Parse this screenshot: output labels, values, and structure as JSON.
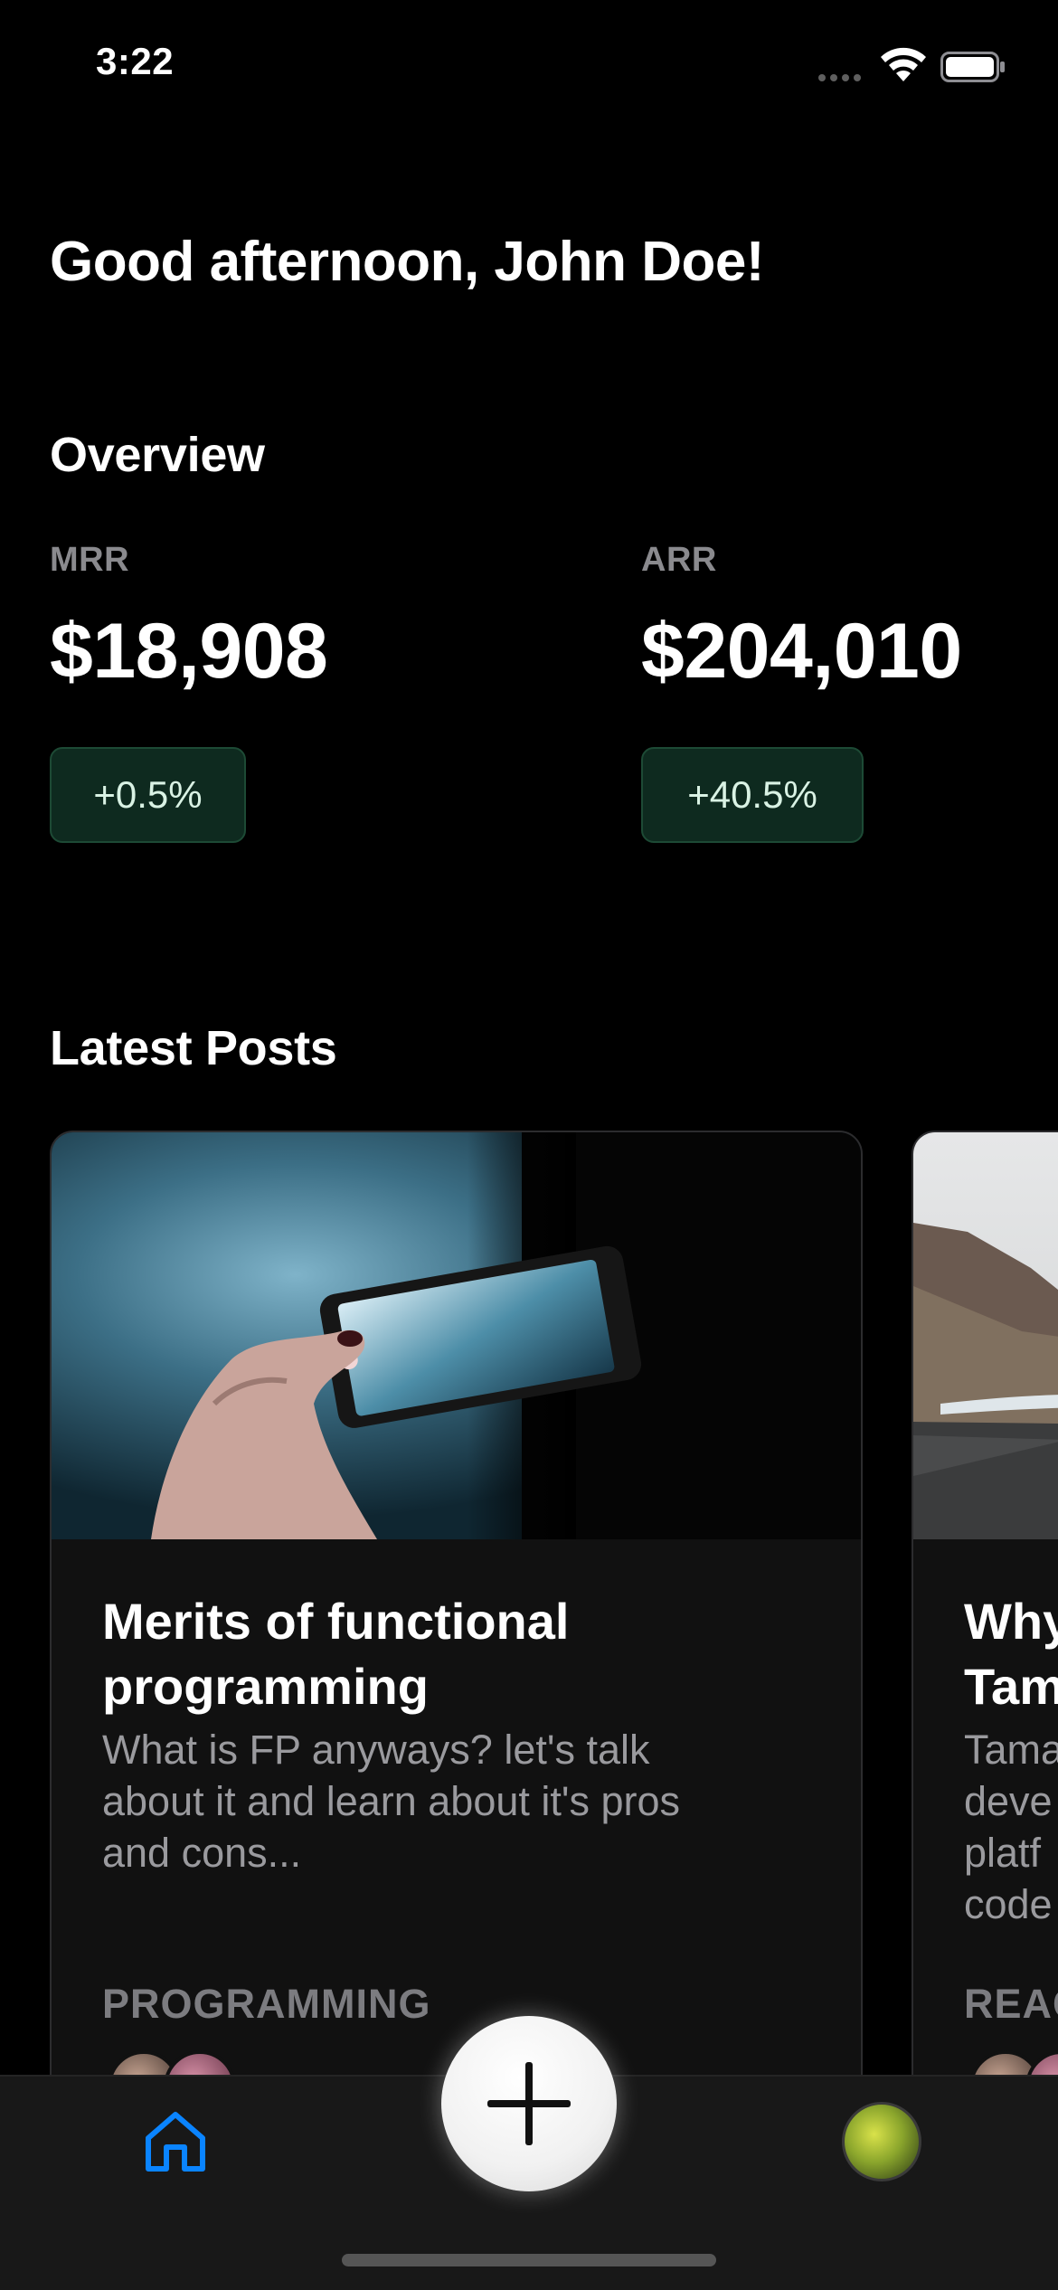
{
  "status_bar": {
    "time": "3:22"
  },
  "greeting": "Good afternoon, John Doe!",
  "overview": {
    "title": "Overview",
    "metrics": [
      {
        "label": "MRR",
        "value": "$18,908",
        "change": "+0.5%"
      },
      {
        "label": "ARR",
        "value": "$204,010",
        "change": "+40.5%"
      }
    ]
  },
  "latest_posts": {
    "title": "Latest Posts",
    "posts": [
      {
        "title_line1": "Merits of functional",
        "title_line2": "programming",
        "desc_line1": "What is FP anyways? let's talk",
        "desc_line2": "about it and learn about it's pros",
        "desc_line3": "and cons...",
        "desc_line4": "",
        "tag": "PROGRAMMING"
      },
      {
        "title_line1": "Why",
        "title_line2": "Tam",
        "desc_line1": "Tama",
        "desc_line2": "deve",
        "desc_line3": "platf",
        "desc_line4": "code",
        "tag": "REAC"
      }
    ]
  },
  "tab_bar": {
    "home_icon": "home-icon",
    "add_icon": "plus-icon",
    "profile_icon": "avatar"
  },
  "colors": {
    "background": "#000000",
    "badge_bg": "#0e2a1f",
    "tab_active": "#0a84ff"
  }
}
